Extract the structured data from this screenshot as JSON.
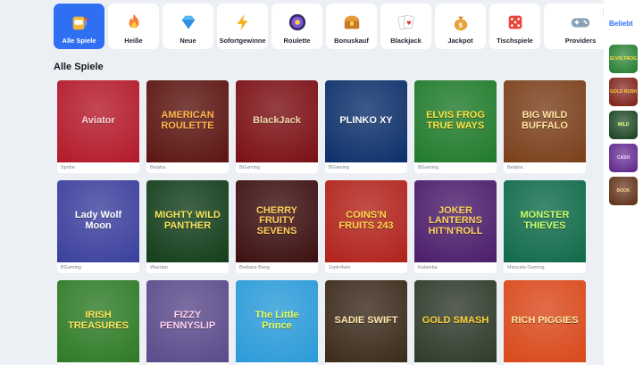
{
  "categories": [
    {
      "label": "Alle Spiele",
      "icon": "slot-machine-icon",
      "active": true
    },
    {
      "label": "Heiße",
      "icon": "flame-icon",
      "active": false
    },
    {
      "label": "Neue",
      "icon": "diamond-icon",
      "active": false
    },
    {
      "label": "Sofortgewinne",
      "icon": "lightning-icon",
      "active": false
    },
    {
      "label": "Roulette",
      "icon": "roulette-icon",
      "active": false
    },
    {
      "label": "Bonuskauf",
      "icon": "treasure-chest-icon",
      "active": false
    },
    {
      "label": "Blackjack",
      "icon": "playing-cards-icon",
      "active": false
    },
    {
      "label": "Jackpot",
      "icon": "money-bag-icon",
      "active": false
    },
    {
      "label": "Tischspiele",
      "icon": "dice-icon",
      "active": false
    },
    {
      "label": "Providers",
      "icon": "gamepad-icon",
      "active": false
    }
  ],
  "section_title": "Alle Spiele",
  "games": [
    {
      "title": "Aviator",
      "provider": "Spribe",
      "bg": "#b3192a",
      "fg": "#ffd1d6"
    },
    {
      "title": "AMERICAN ROULETTE",
      "provider": "Belatra",
      "bg": "#5a1410",
      "fg": "#ffb64a"
    },
    {
      "title": "BlackJack",
      "provider": "BGaming",
      "bg": "#7a0f14",
      "fg": "#f1d9a6"
    },
    {
      "title": "PLINKO XY",
      "provider": "BGaming",
      "bg": "#0c2f6a",
      "fg": "#ffffff"
    },
    {
      "title": "ELVIS FROG TRUE WAYS",
      "provider": "BGaming",
      "bg": "#1f7a2a",
      "fg": "#ffe23d"
    },
    {
      "title": "BIG WILD BUFFALO",
      "provider": "Belatra",
      "bg": "#7a3f1a",
      "fg": "#ffe2a0"
    },
    {
      "title": "Lady Wolf Moon",
      "provider": "BGaming",
      "bg": "#3a3f9c",
      "fg": "#ffffff"
    },
    {
      "title": "MIGHTY WILD PANTHER",
      "provider": "Wazdan",
      "bg": "#123d1a",
      "fg": "#f6e35a"
    },
    {
      "title": "CHERRY FRUITY SEVENS",
      "provider": "Barbara Bang",
      "bg": "#3b0f10",
      "fg": "#ffcf5a"
    },
    {
      "title": "COINS'N FRUITS 243",
      "provider": "1spin4win",
      "bg": "#b0221a",
      "fg": "#ffd94a"
    },
    {
      "title": "JOKER LANTERNS HIT'N'ROLL",
      "provider": "Kalamba",
      "bg": "#4a1c6a",
      "fg": "#ffd25a"
    },
    {
      "title": "MONSTER THIEVES",
      "provider": "Mancala Gaming",
      "bg": "#0f6a4a",
      "fg": "#c9ff6a"
    },
    {
      "title": "IRISH TREASURES",
      "provider": "",
      "bg": "#2e7a26",
      "fg": "#ffe55a"
    },
    {
      "title": "FIZZY PENNYSLIP",
      "provider": "",
      "bg": "#5a4a8a",
      "fg": "#ffd0f0"
    },
    {
      "title": "The Little Prince",
      "provider": "",
      "bg": "#2a9ad8",
      "fg": "#eaff5a"
    },
    {
      "title": "SADIE SWIFT",
      "provider": "",
      "bg": "#3a2a1a",
      "fg": "#ffe6b0"
    },
    {
      "title": "GOLD SMASH",
      "provider": "",
      "bg": "#2f3a2a",
      "fg": "#ffd23a"
    },
    {
      "title": "RICH PIGGIES",
      "provider": "",
      "bg": "#d9481a",
      "fg": "#ffe8a0"
    }
  ],
  "sidebar": {
    "title": "Beliebt",
    "items": [
      {
        "label": "ELVIS FROG",
        "bg": "#1f7a2a",
        "fg": "#ffe23d"
      },
      {
        "label": "GOLD RUSH",
        "bg": "#7a1a10",
        "fg": "#ffd23a"
      },
      {
        "label": "WILD",
        "bg": "#123d1a",
        "fg": "#e8ff7a"
      },
      {
        "label": "CASH",
        "bg": "#5a1f8a",
        "fg": "#ffd0ff"
      },
      {
        "label": "BOOK",
        "bg": "#5a2a10",
        "fg": "#ffd08a"
      }
    ]
  }
}
